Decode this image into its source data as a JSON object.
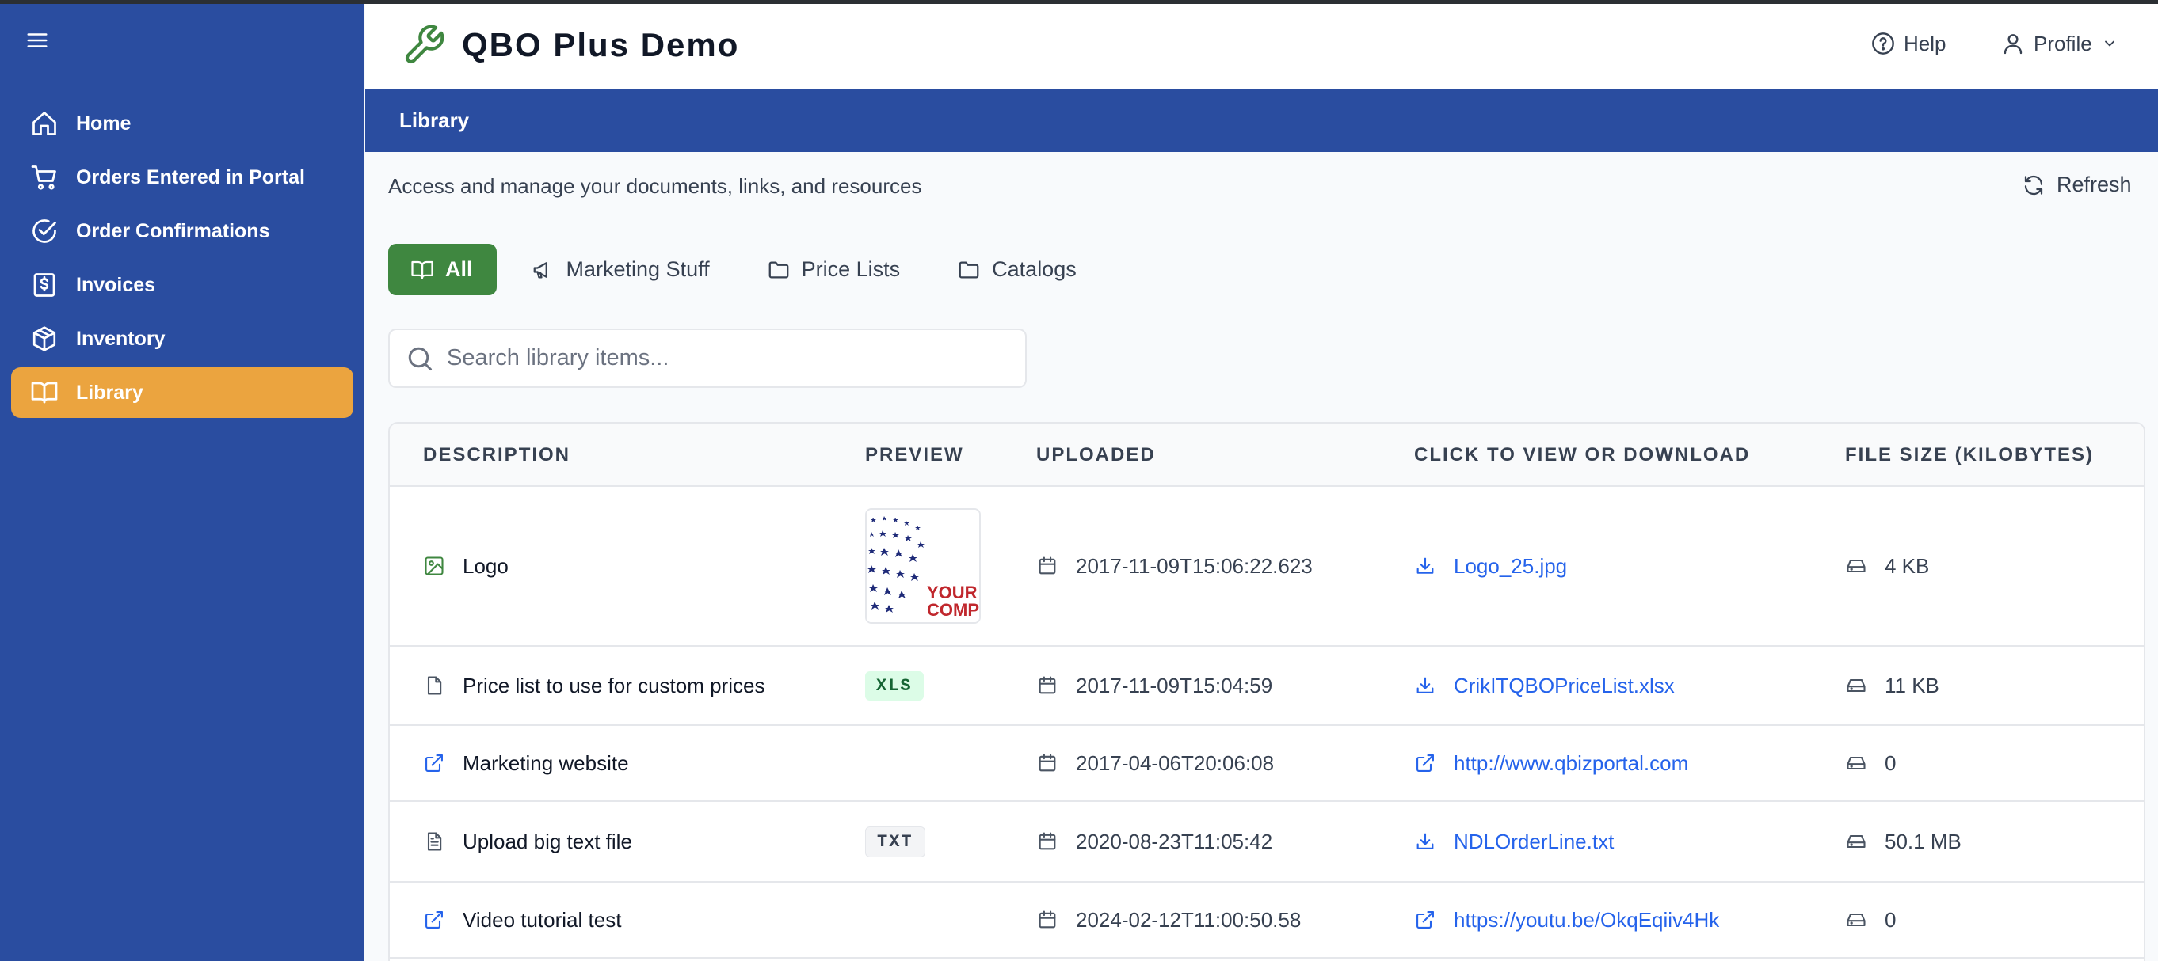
{
  "app": {
    "title": "QBO Plus Demo"
  },
  "header": {
    "help_label": "Help",
    "profile_label": "Profile"
  },
  "sidebar": {
    "items": [
      {
        "label": "Home",
        "icon": "home-icon"
      },
      {
        "label": "Orders Entered in Portal",
        "icon": "cart-icon"
      },
      {
        "label": "Order Confirmations",
        "icon": "check-circle-icon"
      },
      {
        "label": "Invoices",
        "icon": "invoice-icon"
      },
      {
        "label": "Inventory",
        "icon": "box-icon"
      },
      {
        "label": "Library",
        "icon": "book-icon",
        "active": true
      }
    ]
  },
  "page": {
    "title": "Library",
    "subtitle": "Access and manage your documents, links, and resources",
    "refresh_label": "Refresh"
  },
  "tabs": [
    {
      "label": "All",
      "icon": "book-icon",
      "active": true
    },
    {
      "label": "Marketing Stuff",
      "icon": "megaphone-icon"
    },
    {
      "label": "Price Lists",
      "icon": "folder-icon"
    },
    {
      "label": "Catalogs",
      "icon": "folder-icon"
    }
  ],
  "search": {
    "placeholder": "Search library items...",
    "value": ""
  },
  "table": {
    "columns": [
      "DESCRIPTION",
      "PREVIEW",
      "UPLOADED",
      "CLICK TO VIEW OR DOWNLOAD",
      "FILE SIZE (KILOBYTES)"
    ],
    "rows": [
      {
        "description": "Logo",
        "type_icon": "image-icon",
        "preview": "thumbnail",
        "uploaded": "2017-11-09T15:06:22.623",
        "link_icon": "download-icon",
        "link": "Logo_25.jpg",
        "size": "4 KB"
      },
      {
        "description": "Price list to use for custom prices",
        "type_icon": "file-icon",
        "preview": "XLS",
        "uploaded": "2017-11-09T15:04:59",
        "link_icon": "download-icon",
        "link": "CrikITQBOPriceList.xlsx",
        "size": "11 KB"
      },
      {
        "description": "Marketing website",
        "type_icon": "external-link-icon",
        "preview": "",
        "uploaded": "2017-04-06T20:06:08",
        "link_icon": "external-link-icon",
        "link": "http://www.qbizportal.com",
        "size": "0"
      },
      {
        "description": "Upload big text file",
        "type_icon": "text-file-icon",
        "preview": "TXT",
        "uploaded": "2020-08-23T11:05:42",
        "link_icon": "download-icon",
        "link": "NDLOrderLine.txt",
        "size": "50.1 MB"
      },
      {
        "description": "Video tutorial test",
        "type_icon": "external-link-icon",
        "preview": "",
        "uploaded": "2024-02-12T11:00:50.58",
        "link_icon": "external-link-icon",
        "link": "https://youtu.be/OkqEqiiv4Hk",
        "size": "0"
      }
    ]
  },
  "logo_thumbnail": {
    "text_line1": "YOUR",
    "text_line2": "COMP"
  },
  "colors": {
    "sidebar": "#2a4da0",
    "active_nav": "#eba43f",
    "active_tab": "#3f8740",
    "link": "#2563eb"
  }
}
